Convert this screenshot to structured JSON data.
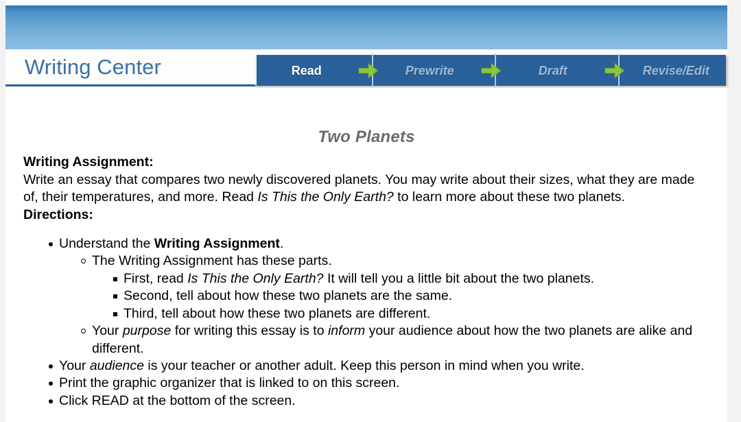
{
  "header": {
    "brand_title": "Writing Center",
    "nav_steps": [
      {
        "label": "Read",
        "state": "active"
      },
      {
        "label": "Prewrite",
        "state": "inactive"
      },
      {
        "label": "Draft",
        "state": "inactive"
      },
      {
        "label": "Revise/Edit",
        "state": "inactive"
      }
    ],
    "arrow_icon_name": "green-arrow-right-icon"
  },
  "colors": {
    "brand_blue": "#3b6fa6",
    "nav_bar_blue": "#2a6099",
    "nav_active_text": "#ffffff",
    "nav_inactive_text": "#9fb9d4",
    "arrow_green": "#8dc63f",
    "banner_gradient_top": "#2f7ab8",
    "banner_gradient_bottom": "#8dbde2",
    "doc_title_gray": "#6b6b6b",
    "page_background": "#f2f2f2"
  },
  "main": {
    "doc_title": "Two Planets",
    "assignment_label": "Writing Assignment:",
    "assignment_text_1": "Write an essay that compares two newly discovered planets. You may write about their sizes, what they are made of, their temperatures, and more. Read ",
    "assignment_book_title": "Is This the Only Earth?",
    "assignment_text_2": " to learn more about these two planets.",
    "directions_label": "Directions:",
    "bullets": {
      "b1_pre": "Understand the ",
      "b1_bold": "Writing Assignment",
      "b1_post": ".",
      "b1_sub1": "The Writing Assignment has these parts.",
      "b1_sub1_items": {
        "i1_pre": "First, read ",
        "i1_ital": "Is This the Only Earth?",
        "i1_post": " It will tell you a little bit about the two planets.",
        "i2": "Second, tell about how these two planets are the same.",
        "i3": "Third, tell about how these two planets are different."
      },
      "b1_sub2_pre": "Your ",
      "b1_sub2_ital1": "purpose",
      "b1_sub2_mid": " for writing this essay is to ",
      "b1_sub2_ital2": "inform",
      "b1_sub2_post": " your audience about how the two planets are alike and different.",
      "b2_pre": "Your ",
      "b2_ital": "audience",
      "b2_post": " is your teacher or another adult. Keep this person in mind when you write.",
      "b3": "Print the graphic organizer that is linked to on this screen.",
      "b4": "Click READ at the bottom of the screen."
    }
  }
}
